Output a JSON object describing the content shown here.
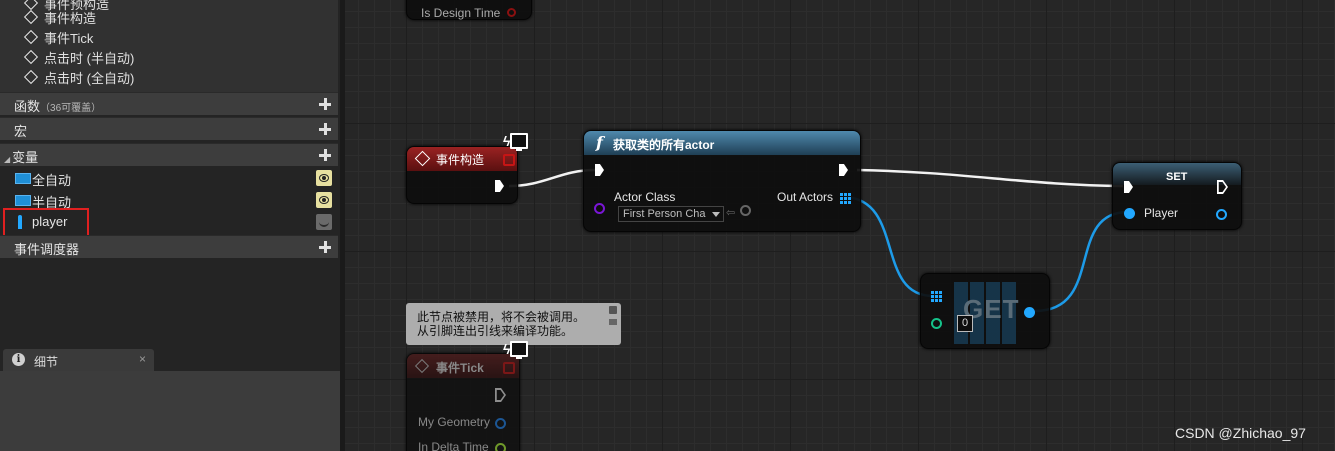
{
  "tree": {
    "items": [
      {
        "label": "事件预构造"
      },
      {
        "label": "事件构造"
      },
      {
        "label": "事件Tick"
      },
      {
        "label": "点击时 (半自动)"
      },
      {
        "label": "点击时 (全自动)"
      }
    ]
  },
  "sections": {
    "functions": {
      "label": "函数",
      "sub": "（36可覆盖）"
    },
    "macros": {
      "label": "宏"
    },
    "variables": {
      "label": "变量"
    },
    "dispatchers": {
      "label": "事件调度器"
    }
  },
  "variables": [
    {
      "name": "全自动",
      "visibility": "public"
    },
    {
      "name": "半自动",
      "visibility": "public"
    },
    {
      "name": "player",
      "visibility": "private",
      "highlighted": true
    }
  ],
  "details_tab": {
    "label": "细节",
    "close": "×"
  },
  "graph": {
    "top_node_pin": "Is Design Time",
    "construct_node": {
      "title": "事件构造"
    },
    "get_all_actors": {
      "title": "获取类的所有actor",
      "function_glyph": "f",
      "actor_class_label": "Actor Class",
      "actor_class_value": "First Person Cha",
      "out_actors_label": "Out Actors"
    },
    "set_node": {
      "title": "SET",
      "player_label": "Player"
    },
    "get_node": {
      "title": "GET",
      "index_value": "0"
    },
    "tick_node": {
      "title": "事件Tick",
      "pin_geometry": "My Geometry",
      "pin_delta": "In Delta Time"
    },
    "disabled_tooltip": {
      "line1": "此节点被禁用，将不会被调用。",
      "line2": "从引脚连出引线来编译功能。"
    }
  },
  "colors": {
    "object_pin": "#22a8ff",
    "class_pin": "#7a16d6",
    "event_header": "#8b1c1c",
    "function_header": "#2c5a78",
    "highlight_box": "#e02020"
  },
  "watermark": "CSDN @Zhichao_97"
}
